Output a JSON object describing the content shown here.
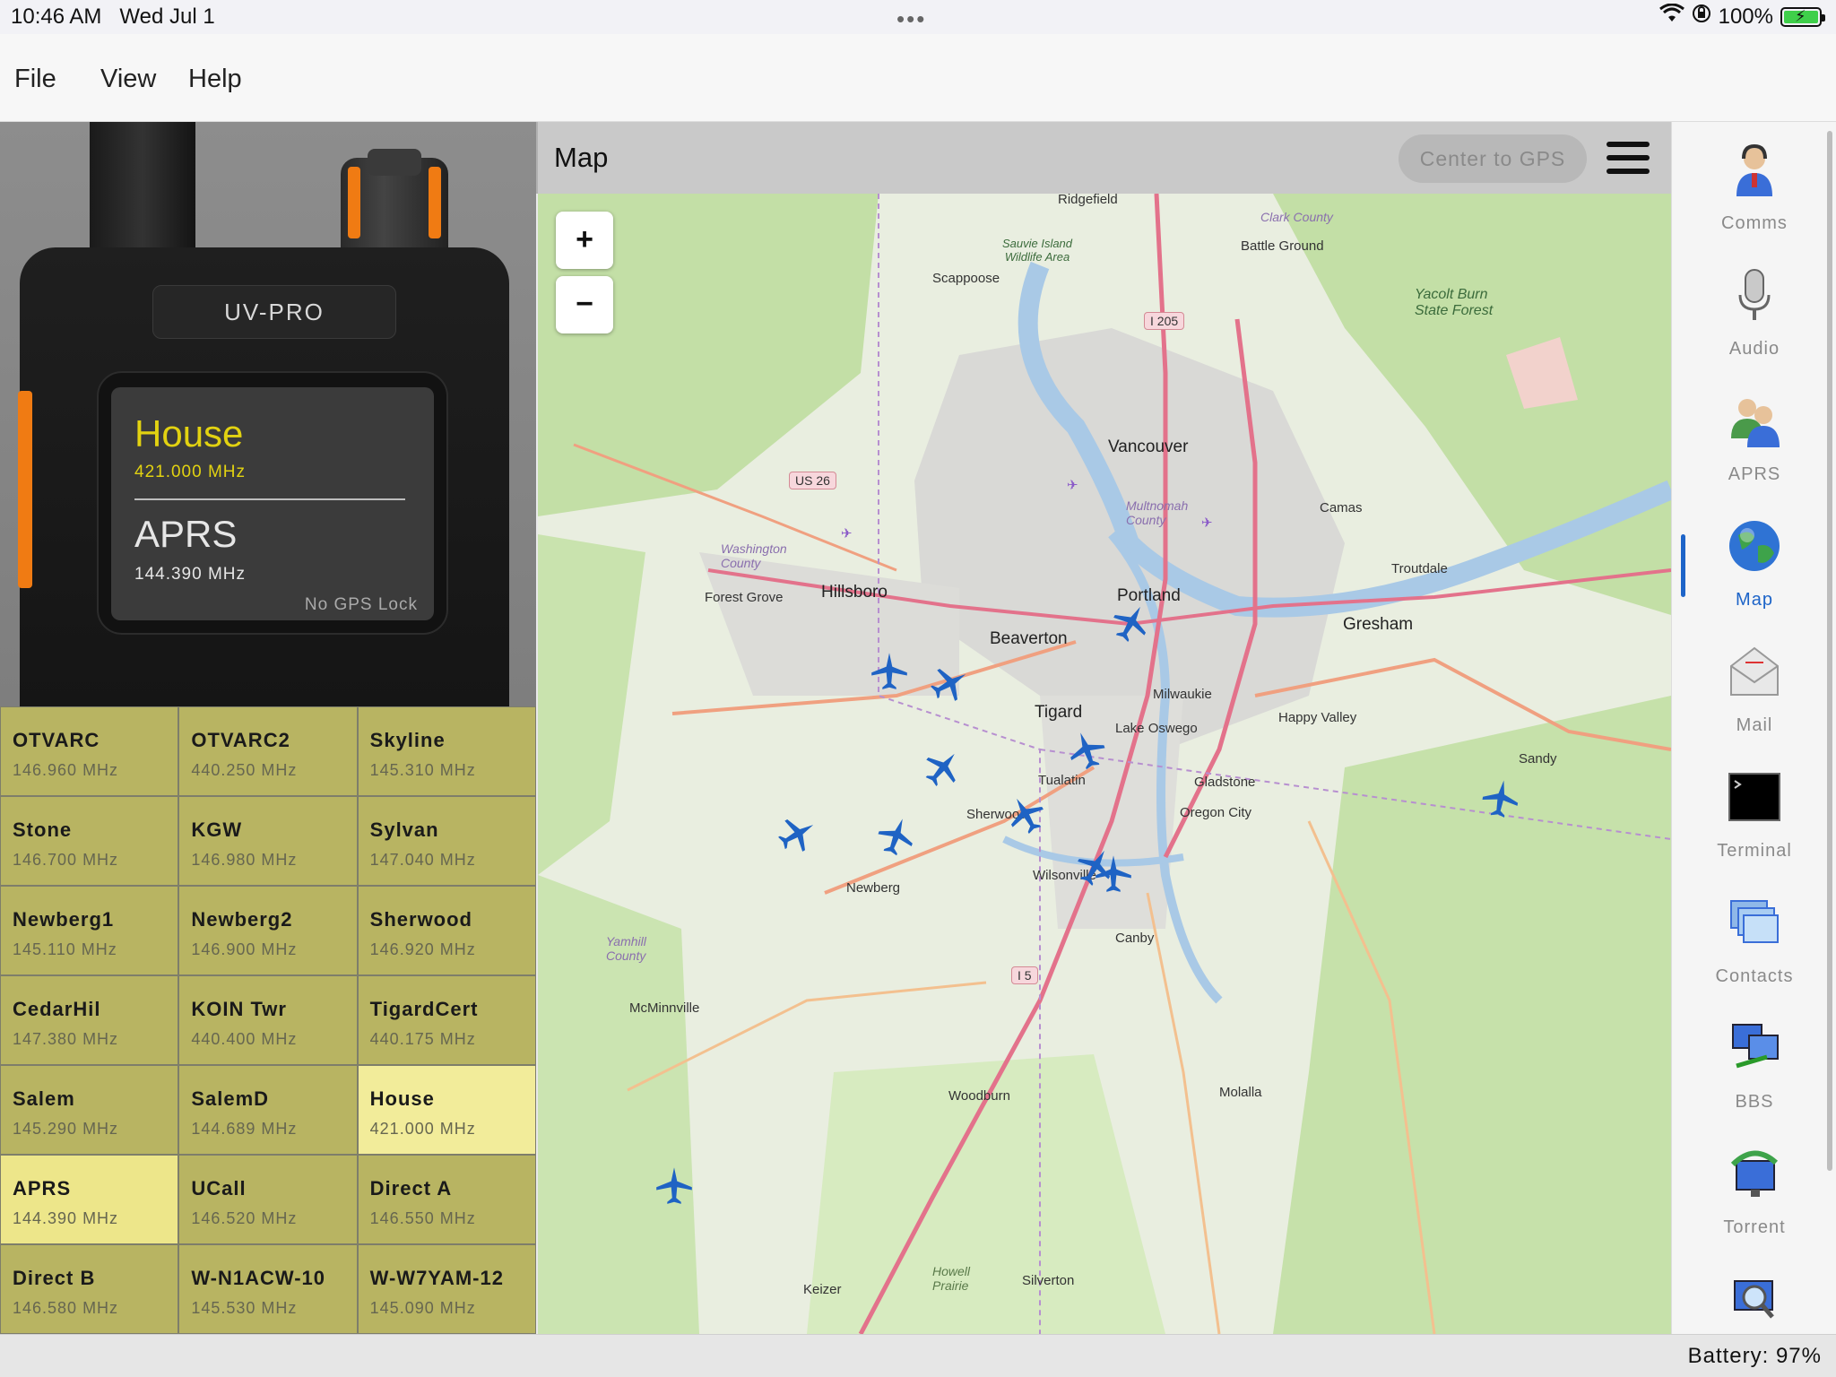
{
  "status": {
    "time": "10:46 AM",
    "date": "Wed Jul 1",
    "battery_pct": "100%",
    "dots": "•••"
  },
  "menu": {
    "file": "File",
    "view": "View",
    "help": "Help"
  },
  "radio": {
    "brand": "UV-PRO",
    "vfo_a": {
      "name": "House",
      "freq": "421.000 MHz"
    },
    "vfo_b": {
      "name": "APRS",
      "freq": "144.390 MHz"
    },
    "gps_status": "No GPS Lock",
    "accent_color": "#e2d211"
  },
  "channels": [
    {
      "name": "OTVARC",
      "freq": "146.960 MHz"
    },
    {
      "name": "OTVARC2",
      "freq": "440.250 MHz"
    },
    {
      "name": "Skyline",
      "freq": "145.310 MHz"
    },
    {
      "name": "Stone",
      "freq": "146.700 MHz"
    },
    {
      "name": "KGW",
      "freq": "146.980 MHz"
    },
    {
      "name": "Sylvan",
      "freq": "147.040 MHz"
    },
    {
      "name": "Newberg1",
      "freq": "145.110 MHz"
    },
    {
      "name": "Newberg2",
      "freq": "146.900 MHz"
    },
    {
      "name": "Sherwood",
      "freq": "146.920 MHz"
    },
    {
      "name": "CedarHil",
      "freq": "147.380 MHz"
    },
    {
      "name": "KOIN Twr",
      "freq": "440.400 MHz"
    },
    {
      "name": "TigardCert",
      "freq": "440.175 MHz"
    },
    {
      "name": "Salem",
      "freq": "145.290 MHz"
    },
    {
      "name": "SalemD",
      "freq": "144.689 MHz"
    },
    {
      "name": "House",
      "freq": "421.000 MHz"
    },
    {
      "name": "APRS",
      "freq": "144.390 MHz"
    },
    {
      "name": "UCall",
      "freq": "146.520 MHz"
    },
    {
      "name": "Direct A",
      "freq": "146.550 MHz"
    },
    {
      "name": "Direct B",
      "freq": "146.580 MHz"
    },
    {
      "name": "W-N1ACW-10",
      "freq": "145.530 MHz"
    },
    {
      "name": "W-W7YAM-12",
      "freq": "145.090 MHz"
    }
  ],
  "map": {
    "title": "Map",
    "center_button": "Center to GPS",
    "zoom_in": "+",
    "zoom_out": "−",
    "places": {
      "ridgefield": "Ridgefield",
      "clark": "Clark County",
      "battle_ground": "Battle Ground",
      "sauvie": "Sauvie Island Wildlife Area",
      "scappoose": "Scappoose",
      "yacolt": "Yacolt Burn State Forest",
      "vancouver": "Vancouver",
      "multnomah": "Multnomah County",
      "camas": "Camas",
      "washington": "Washington County",
      "troutdale": "Troutdale",
      "forest_grove": "Forest Grove",
      "hillsboro": "Hillsboro",
      "portland": "Portland",
      "gresham": "Gresham",
      "beaverton": "Beaverton",
      "milwaukie": "Milwaukie",
      "happy_valley": "Happy Valley",
      "tigard": "Tigard",
      "lake_oswego": "Lake Oswego",
      "sandy": "Sandy",
      "tualatin": "Tualatin",
      "gladstone": "Gladstone",
      "oregon_city": "Oregon City",
      "sherwood": "Sherwood",
      "wilsonville": "Wilsonville",
      "newberg": "Newberg",
      "yamhill": "Yamhill County",
      "canby": "Canby",
      "mcminnville": "McMinnville",
      "woodburn": "Woodburn",
      "molalla": "Molalla",
      "howell": "Howell Prairie",
      "keizer": "Keizer",
      "silverton": "Silverton"
    },
    "shields": {
      "i205": "I 205",
      "us26": "US 26",
      "i5": "I 5"
    }
  },
  "sidebar": {
    "items": [
      {
        "label": "Comms",
        "icon": "comms-icon"
      },
      {
        "label": "Audio",
        "icon": "microphone-icon"
      },
      {
        "label": "APRS",
        "icon": "aprs-users-icon"
      },
      {
        "label": "Map",
        "icon": "globe-icon"
      },
      {
        "label": "Mail",
        "icon": "mail-icon"
      },
      {
        "label": "Terminal",
        "icon": "terminal-icon"
      },
      {
        "label": "Contacts",
        "icon": "contacts-icon"
      },
      {
        "label": "BBS",
        "icon": "bbs-icon"
      },
      {
        "label": "Torrent",
        "icon": "torrent-icon"
      }
    ],
    "active": "Map",
    "active_color": "#1d64c8"
  },
  "footer": {
    "battery": "Battery: 97%"
  }
}
